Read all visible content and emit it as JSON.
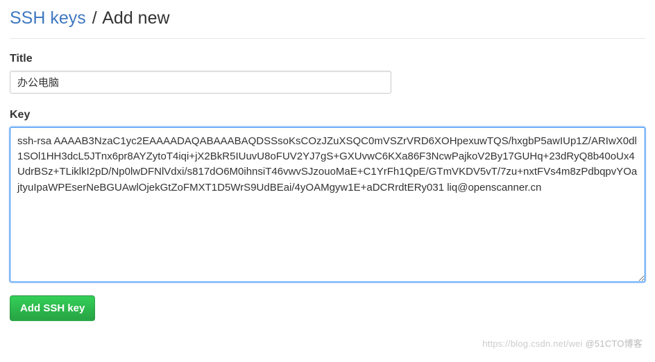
{
  "header": {
    "link": "SSH keys",
    "separator": "/",
    "current": "Add new"
  },
  "form": {
    "title_label": "Title",
    "title_value": "办公电脑",
    "key_label": "Key",
    "key_value": "ssh-rsa AAAAB3NzaC1yc2EAAAADAQABAAABAQDSSsoKsCOzJZuXSQC0mVSZrVRD6XOHpexuwTQS/hxgbP5awIUp1Z/ARIwX0dl1SOl1HH3dcL5JTnx6pr8AYZytoT4iqi+jX2BkR5IUuvU8oFUV2YJ7gS+GXUvwC6KXa86F3NcwPajkoV2By17GUHq+23dRyQ8b40oUx4UdrBSz+TLiklkI2pD/Np0lwDFNlVdxi/s817dO6M0ihnsiT46vwvSJzouoMaE+C1YrFh1QpE/GTmVKDV5vT/7zu+nxtFVs4m8zPdbqpvYOajtyuIpaWPEserNeBGUAwlOjekGtZoFMXT1D5WrS9UdBEai/4yOAMgyw1E+aDCRrdtERy031 liq@openscanner.cn",
    "submit_label": "Add SSH key"
  },
  "watermark": {
    "left": "https://blog.csdn.net/wei",
    "right": "@51CTO博客"
  }
}
